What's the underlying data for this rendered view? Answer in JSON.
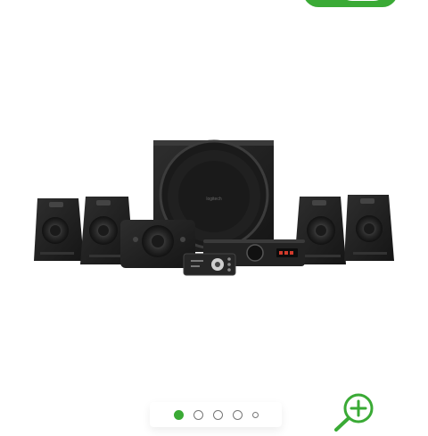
{
  "header": {
    "accent_color": "#3aaa35"
  },
  "product_image": {
    "alt": "logitech"
  },
  "gallery": {
    "slide_count": 5,
    "active_index": 0,
    "active_color": "#3aaa35"
  },
  "zoom": {
    "icon": "zoom-in-icon",
    "color": "#3aaa35"
  }
}
